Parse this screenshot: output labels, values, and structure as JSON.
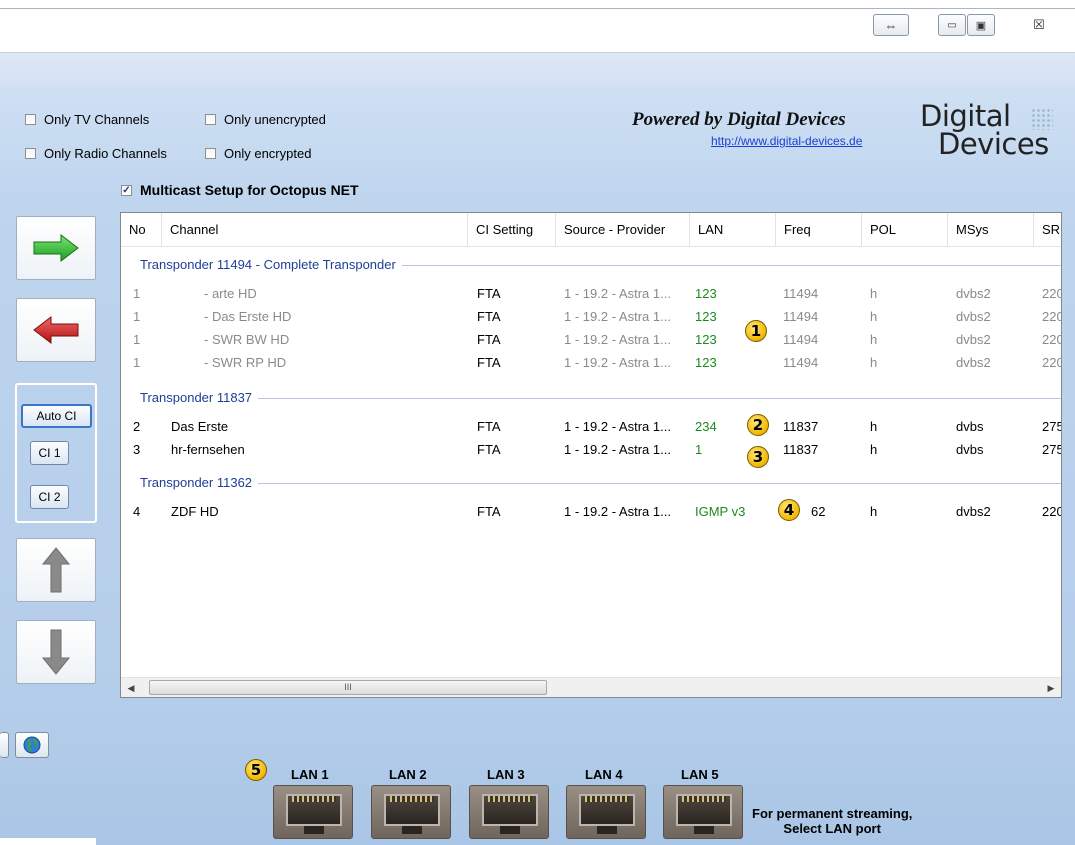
{
  "window": {
    "resize_glyph": "⇔",
    "minimize_glyph": "▭",
    "maximize_glyph": "▣",
    "close_glyph": "☒"
  },
  "filters": {
    "only_tv": "Only TV Channels",
    "only_radio": "Only Radio Channels",
    "only_unencrypted": "Only unencrypted",
    "only_encrypted": "Only encrypted"
  },
  "branding": {
    "powered_by": "Powered by Digital Devices",
    "url": "http://www.digital-devices.de",
    "logo_line1": "Digital",
    "logo_line2": "Devices"
  },
  "multicast_label": "Multicast Setup for Octopus NET",
  "ci_buttons": {
    "auto": "Auto CI",
    "ci1": "CI 1",
    "ci2": "CI 2"
  },
  "columns": [
    "No",
    "Channel",
    "CI Setting",
    "Source - Provider",
    "LAN",
    "Freq",
    "POL",
    "MSys",
    "SR"
  ],
  "groups": [
    {
      "title": "Transponder 11494 - Complete Transponder",
      "rows": [
        {
          "no": "1",
          "channel": "- arte HD",
          "ci": "FTA",
          "source": "1 - 19.2 - Astra 1...",
          "lan": "123",
          "freq": "11494",
          "pol": "h",
          "msys": "dvbs2",
          "sr": "220"
        },
        {
          "no": "1",
          "channel": "- Das Erste HD",
          "ci": "FTA",
          "source": "1 - 19.2 - Astra 1...",
          "lan": "123",
          "freq": "11494",
          "pol": "h",
          "msys": "dvbs2",
          "sr": "220"
        },
        {
          "no": "1",
          "channel": "- SWR BW HD",
          "ci": "FTA",
          "source": "1 - 19.2 - Astra 1...",
          "lan": "123",
          "freq": "11494",
          "pol": "h",
          "msys": "dvbs2",
          "sr": "220"
        },
        {
          "no": "1",
          "channel": "- SWR RP HD",
          "ci": "FTA",
          "source": "1 - 19.2 - Astra 1...",
          "lan": "123",
          "freq": "11494",
          "pol": "h",
          "msys": "dvbs2",
          "sr": "220"
        }
      ]
    },
    {
      "title": "Transponder 11837",
      "rows": [
        {
          "no": "2",
          "channel": "Das Erste",
          "ci": "FTA",
          "source": "1 - 19.2 - Astra 1...",
          "lan": "234",
          "freq": "11837",
          "pol": "h",
          "msys": "dvbs",
          "sr": "275"
        },
        {
          "no": "3",
          "channel": "hr-fernsehen",
          "ci": "FTA",
          "source": "1 - 19.2 - Astra 1...",
          "lan": "1",
          "freq": "11837",
          "pol": "h",
          "msys": "dvbs",
          "sr": "275"
        }
      ]
    },
    {
      "title": "Transponder 11362",
      "rows": [
        {
          "no": "4",
          "channel": "ZDF HD",
          "ci": "FTA",
          "source": "1 - 19.2 - Astra 1...",
          "lan": "IGMP v3",
          "freq": "62",
          "pol": "h",
          "msys": "dvbs2",
          "sr": "220"
        }
      ]
    }
  ],
  "badges": [
    "1",
    "2",
    "3",
    "4",
    "5"
  ],
  "scrollbar": {
    "left_arrow": "◀",
    "right_arrow": "▶",
    "thumb_grip": "III"
  },
  "lan_ports": [
    "LAN 1",
    "LAN 2",
    "LAN 3",
    "LAN 4",
    "LAN 5"
  ],
  "permanent_note_line1": "For permanent streaming,",
  "permanent_note_line2": "Select LAN port",
  "colors": {
    "group_title": "#1e3f96",
    "lan_value": "#1d8a1d",
    "link": "#1a3fd6",
    "badge": "#f2b600"
  }
}
